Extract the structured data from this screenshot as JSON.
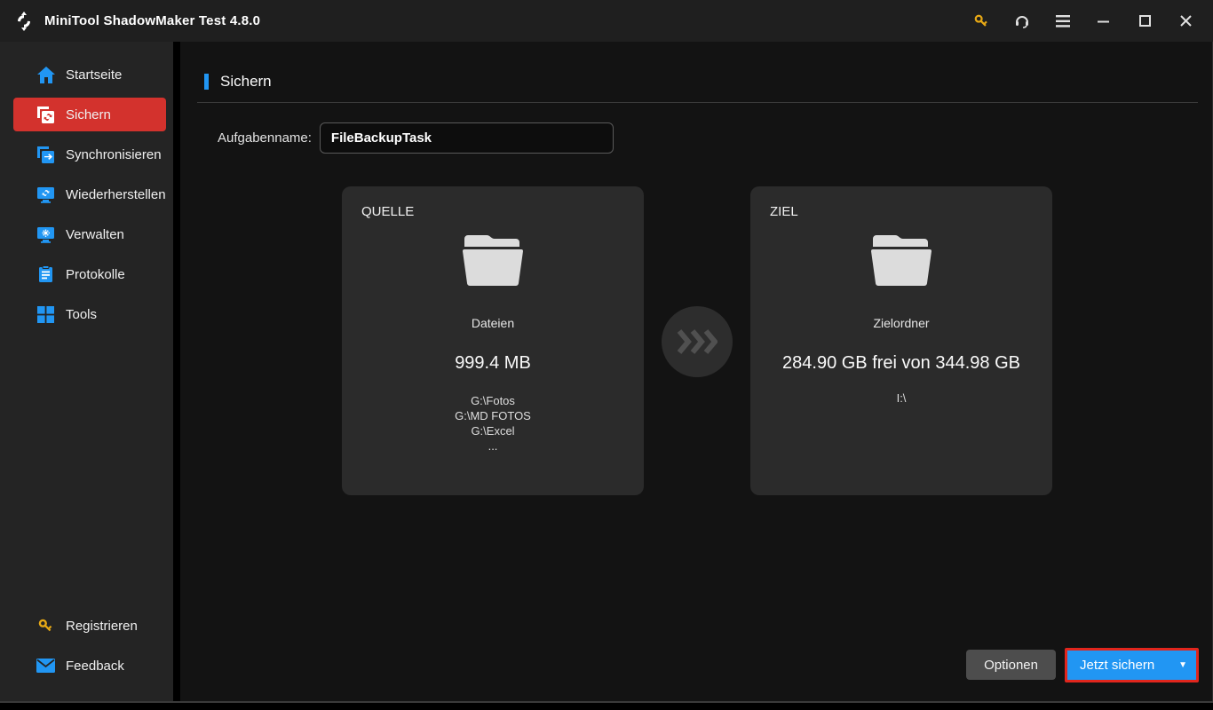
{
  "titlebar": {
    "title": "MiniTool ShadowMaker Test 4.8.0",
    "icons": [
      "key",
      "headset",
      "menu",
      "minimize",
      "maximize",
      "close"
    ]
  },
  "sidebar": {
    "items": [
      {
        "label": "Startseite",
        "icon": "home",
        "active": false
      },
      {
        "label": "Sichern",
        "icon": "backup",
        "active": true
      },
      {
        "label": "Synchronisieren",
        "icon": "sync",
        "active": false
      },
      {
        "label": "Wiederherstellen",
        "icon": "restore",
        "active": false
      },
      {
        "label": "Verwalten",
        "icon": "manage",
        "active": false
      },
      {
        "label": "Protokolle",
        "icon": "logs",
        "active": false
      },
      {
        "label": "Tools",
        "icon": "tools",
        "active": false
      }
    ],
    "bottom_items": [
      {
        "label": "Registrieren",
        "icon": "key"
      },
      {
        "label": "Feedback",
        "icon": "mail"
      }
    ]
  },
  "main": {
    "section_title": "Sichern",
    "task_name_label": "Aufgabenname:",
    "task_name_value": "FileBackupTask",
    "source_card": {
      "title": "QUELLE",
      "name": "Dateien",
      "size": "999.4 MB",
      "paths": [
        "G:\\Fotos",
        "G:\\MD FOTOS",
        "G:\\Excel",
        "..."
      ]
    },
    "target_card": {
      "title": "ZIEL",
      "name": "Zielordner",
      "space": "284.90 GB frei von 344.98 GB",
      "path": "I:\\"
    },
    "buttons": {
      "options": "Optionen",
      "backup_now": "Jetzt sichern"
    }
  },
  "colors": {
    "accent_blue": "#2196f3",
    "active_red": "#d3322d",
    "highlight_border_red": "#e1261d",
    "gold_key": "#e8a915",
    "titlebar_bg": "#1f1f1f",
    "sidebar_bg": "#242424",
    "main_bg": "#131313",
    "card_bg": "#2b2b2b"
  }
}
